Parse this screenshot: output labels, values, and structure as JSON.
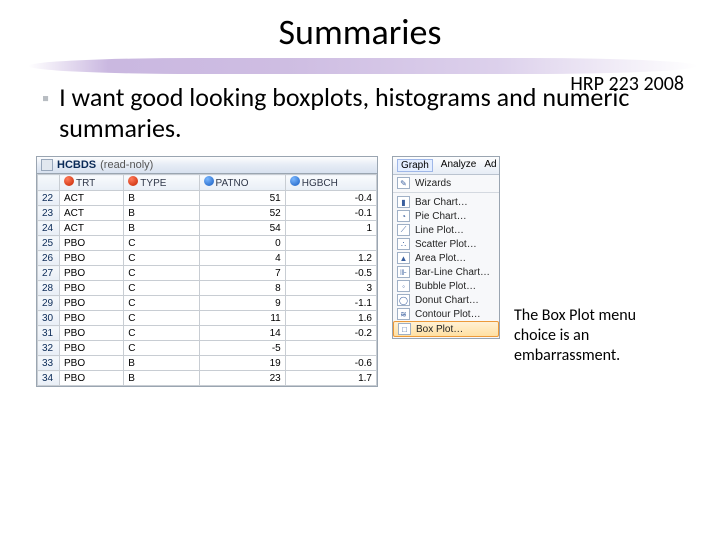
{
  "title": "Summaries",
  "course": "HRP 223 2008",
  "bullet": "I want good looking boxplots, histograms and numeric summaries.",
  "data_window": {
    "name": "HCBDS",
    "mode": "(read-noly)",
    "columns": [
      "TRT",
      "TYPE",
      "PATNO",
      "HGBCH"
    ],
    "col_icons": [
      "red",
      "red",
      "blue",
      "blue"
    ],
    "rows": [
      {
        "n": "22",
        "c": [
          "ACT",
          "B",
          "51",
          "-0.4"
        ]
      },
      {
        "n": "23",
        "c": [
          "ACT",
          "B",
          "52",
          "-0.1"
        ]
      },
      {
        "n": "24",
        "c": [
          "ACT",
          "B",
          "54",
          "1"
        ]
      },
      {
        "n": "25",
        "c": [
          "PBO",
          "C",
          "0",
          ""
        ]
      },
      {
        "n": "26",
        "c": [
          "PBO",
          "C",
          "4",
          "1.2"
        ]
      },
      {
        "n": "27",
        "c": [
          "PBO",
          "C",
          "7",
          "-0.5"
        ]
      },
      {
        "n": "28",
        "c": [
          "PBO",
          "C",
          "8",
          "3"
        ]
      },
      {
        "n": "29",
        "c": [
          "PBO",
          "C",
          "9",
          "-1.1"
        ]
      },
      {
        "n": "30",
        "c": [
          "PBO",
          "C",
          "11",
          "1.6"
        ]
      },
      {
        "n": "31",
        "c": [
          "PBO",
          "C",
          "14",
          "-0.2"
        ]
      },
      {
        "n": "32",
        "c": [
          "PBO",
          "C",
          "-5",
          ""
        ]
      },
      {
        "n": "33",
        "c": [
          "PBO",
          "B",
          "19",
          "-0.6"
        ]
      },
      {
        "n": "34",
        "c": [
          "PBO",
          "B",
          "23",
          "1.7"
        ]
      }
    ]
  },
  "menu": {
    "top": [
      "Graph",
      "Analyze",
      "Ad"
    ],
    "heading": "Wizards",
    "items": [
      "Bar Chart…",
      "Pie Chart…",
      "Line Plot…",
      "Scatter Plot…",
      "Area Plot…",
      "Bar-Line Chart…",
      "Bubble Plot…",
      "Donut Chart…",
      "Contour Plot…",
      "Box Plot…"
    ],
    "icons": [
      "▮",
      "◔",
      "⟋",
      "∴",
      "▲",
      "⊪",
      "◦",
      "◯",
      "≋",
      "□"
    ],
    "selected_index": 9
  },
  "note": "The Box Plot menu choice is an embarrassment."
}
